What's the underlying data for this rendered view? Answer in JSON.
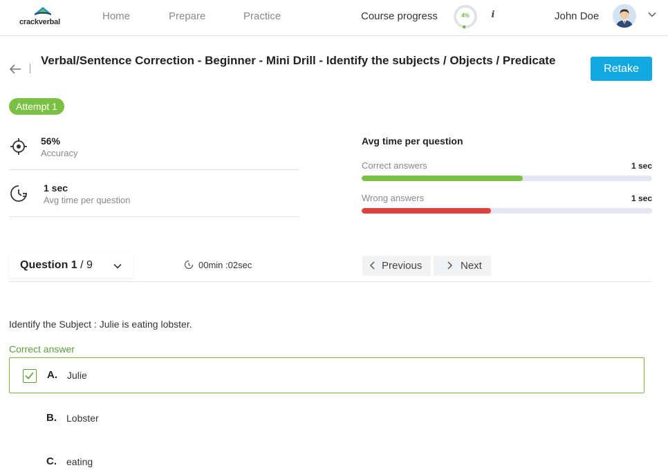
{
  "header": {
    "logo_text": "crackverbal",
    "nav": [
      "Home",
      "Prepare",
      "Practice"
    ],
    "course_progress_label": "Course progress",
    "course_progress_value": "4%",
    "course_progress_fraction": 0.04,
    "info_icon": "i",
    "user_name": "John Doe"
  },
  "page": {
    "title": "Verbal/Sentence Correction - Beginner - Mini Drill - Identify the subjects / Objects / Predicate",
    "retake_label": "Retake",
    "attempt_label": "Attempt 1"
  },
  "stats": {
    "accuracy_value": "56%",
    "accuracy_label": "Accuracy",
    "avg_time_value": "1 sec",
    "avg_time_label": "Avg time per question"
  },
  "avg_time": {
    "title": "Avg time per question",
    "correct_label": "Correct answers",
    "correct_value": "1 sec",
    "correct_fraction": 0.555,
    "wrong_label": "Wrong answers",
    "wrong_value": "1 sec",
    "wrong_fraction": 0.445,
    "colors": {
      "correct": "#79c043",
      "wrong": "#e0413f"
    }
  },
  "question_nav": {
    "question_prefix": "Question",
    "current": "1",
    "total": "/ 9",
    "timer": "00min :02sec",
    "previous_label": "Previous",
    "next_label": "Next"
  },
  "question": {
    "text": "Identify the Subject : Julie is eating lobster.",
    "correct_answer_label": "Correct answer",
    "options": [
      {
        "letter": "A.",
        "text": "Julie"
      },
      {
        "letter": "B.",
        "text": "Lobster"
      },
      {
        "letter": "C.",
        "text": "eating"
      }
    ]
  },
  "icons": {
    "logo": "book-logo-icon",
    "progress": "progress-ring-icon",
    "info": "info-icon",
    "avatar": "user-avatar-icon",
    "user_menu": "chevron-down-icon",
    "back": "arrow-left-icon",
    "accuracy": "target-icon",
    "time": "clock-icon",
    "timer": "timer-icon",
    "prev": "chevron-left-icon",
    "next": "chevron-right-icon",
    "check": "checkbox-checked-icon"
  }
}
